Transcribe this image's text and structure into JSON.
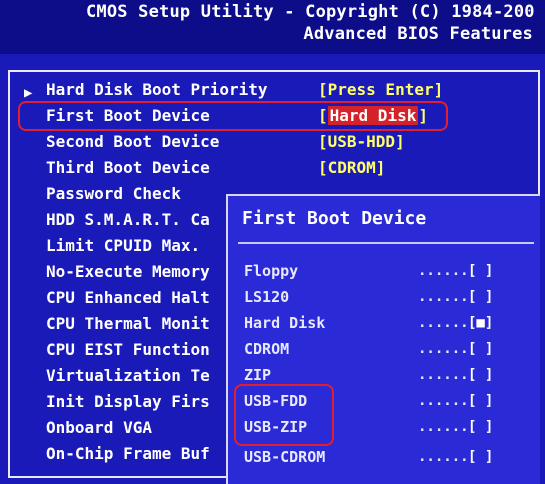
{
  "header": {
    "title": "CMOS Setup Utility - Copyright (C) 1984-200",
    "subtitle": "Advanced BIOS Features"
  },
  "menu": {
    "arrow": "▶",
    "items": [
      {
        "label": "Hard Disk Boot Priority",
        "value": "[Press Enter]"
      },
      {
        "label": "First Boot Device",
        "value": "Hard Disk",
        "bracket_open": "[",
        "bracket_close": "]"
      },
      {
        "label": "Second Boot Device",
        "value": "[USB-HDD]"
      },
      {
        "label": "Third Boot Device",
        "value": "[CDROM]"
      },
      {
        "label": "Password Check"
      },
      {
        "label": "HDD S.M.A.R.T. Ca"
      },
      {
        "label": "Limit CPUID Max."
      },
      {
        "label": "No-Execute Memory"
      },
      {
        "label": "CPU Enhanced Halt"
      },
      {
        "label": "CPU Thermal Monit"
      },
      {
        "label": "CPU EIST Function"
      },
      {
        "label": "Virtualization Te"
      },
      {
        "label": "Init Display Firs"
      },
      {
        "label": "Onboard VGA"
      },
      {
        "label": "On-Chip Frame Buf"
      }
    ]
  },
  "popup": {
    "title": "First Boot Device",
    "options": [
      {
        "label": "Floppy",
        "dots": "......",
        "box": "[ ]",
        "selected": false
      },
      {
        "label": "LS120",
        "dots": "......",
        "box": "[ ]",
        "selected": false
      },
      {
        "label": "Hard Disk",
        "dots": "......",
        "box": "[■]",
        "selected": true
      },
      {
        "label": "CDROM",
        "dots": "......",
        "box": "[ ]",
        "selected": false
      },
      {
        "label": "ZIP",
        "dots": "......",
        "box": "[ ]",
        "selected": false
      },
      {
        "label": "USB-FDD",
        "dots": "......",
        "box": "[ ]",
        "selected": false
      },
      {
        "label": "USB-ZIP",
        "dots": "......",
        "box": "[ ]",
        "selected": false
      },
      {
        "label": "USB-CDROM",
        "dots": "......",
        "box": "[ ]",
        "selected": false
      }
    ]
  },
  "colors": {
    "background": "#1a1ab8",
    "header_bg": "#0d0d8a",
    "popup_bg": "#2a2ad6",
    "value_text": "#ffff66",
    "highlight_bg": "#d4222a",
    "annotation": "#e02030"
  }
}
